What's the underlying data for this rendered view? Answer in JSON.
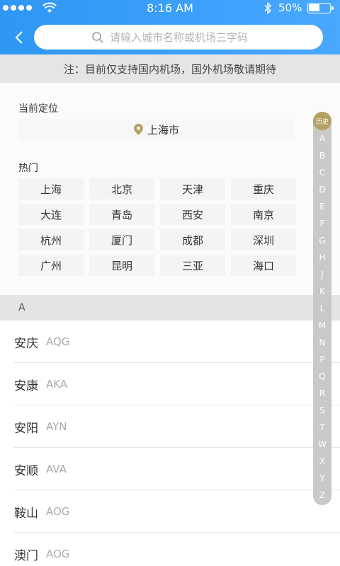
{
  "status_bar": {
    "time": "8:16 AM",
    "battery": "50%"
  },
  "search": {
    "placeholder": "请输入城市名称或机场三字码"
  },
  "notice": "注：目前仅支持国内机场，国外机场敬请期待",
  "location": {
    "label": "当前定位",
    "city": "上海市"
  },
  "hot": {
    "label": "热门",
    "cities": [
      "上海",
      "北京",
      "天津",
      "重庆",
      "大连",
      "青岛",
      "西安",
      "南京",
      "杭州",
      "厦门",
      "成都",
      "深圳",
      "广州",
      "昆明",
      "三亚",
      "海口"
    ]
  },
  "group": {
    "letter": "A"
  },
  "airports": [
    {
      "name": "安庆",
      "code": "AQG"
    },
    {
      "name": "安康",
      "code": "AKA"
    },
    {
      "name": "安阳",
      "code": "AYN"
    },
    {
      "name": "安顺",
      "code": "AVA"
    },
    {
      "name": "鞍山",
      "code": "AOG"
    },
    {
      "name": "澳门",
      "code": "AOG"
    }
  ],
  "index_bar": {
    "history": "历史",
    "letters": [
      "A",
      "B",
      "C",
      "D",
      "E",
      "F",
      "G",
      "H",
      "J",
      "K",
      "L",
      "M",
      "N",
      "P",
      "Q",
      "R",
      "S",
      "T",
      "W",
      "X",
      "Y",
      "Z"
    ]
  },
  "colors": {
    "header_blue": "#3a9ff8",
    "accent_gold": "#b5a063"
  }
}
